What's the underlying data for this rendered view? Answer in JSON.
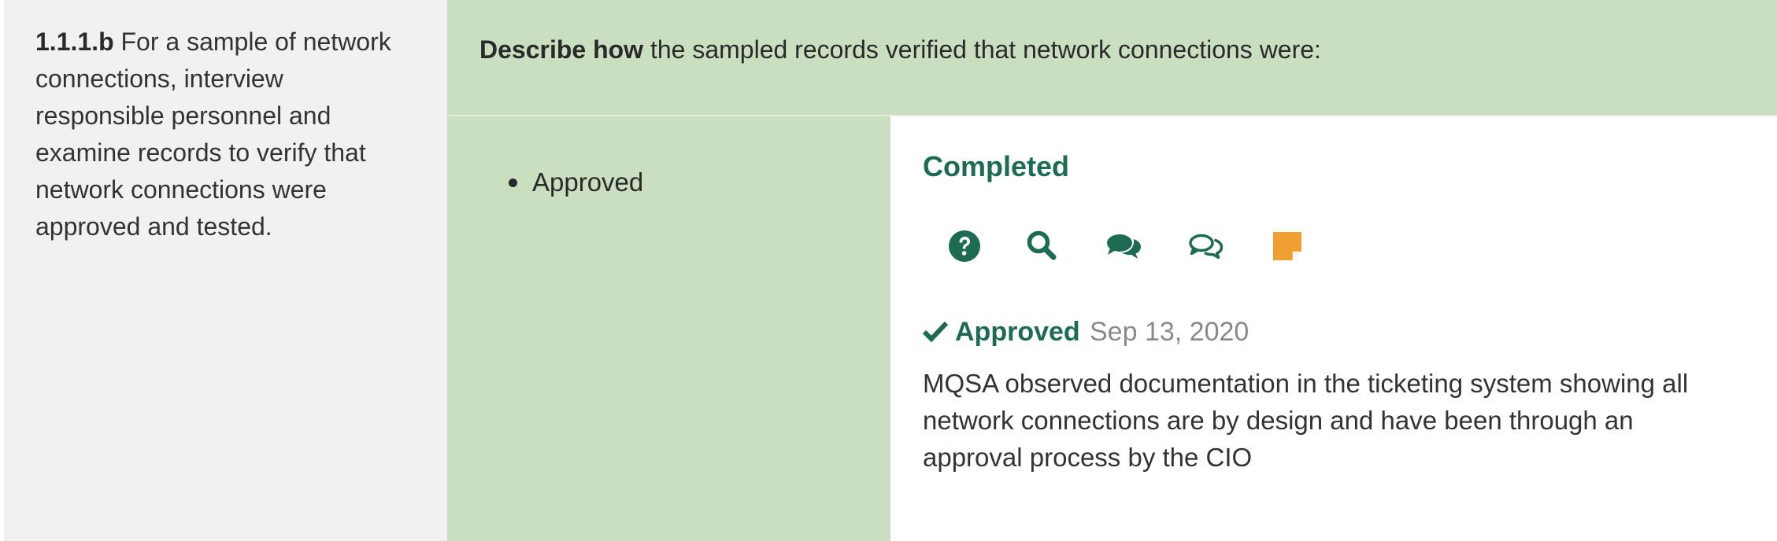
{
  "requirement": {
    "id": "1.1.1.b",
    "text": "For a sample of network connections, interview responsible personnel and examine records to verify that network connections were approved and tested."
  },
  "describe": {
    "lead": "Describe how",
    "rest": " the sampled records verified that network connections were:"
  },
  "items": [
    {
      "label": "Approved"
    }
  ],
  "answer": {
    "status": "Completed",
    "icons": [
      {
        "name": "help-icon",
        "color": "#1d6b52"
      },
      {
        "name": "search-icon",
        "color": "#1d6b52"
      },
      {
        "name": "comments-icon",
        "color": "#1d6b52"
      },
      {
        "name": "comments-outline-icon",
        "color": "#1d6b52"
      },
      {
        "name": "sticky-note-icon",
        "color": "#f0a030"
      }
    ],
    "approval": {
      "label": "Approved",
      "date": "Sep 13, 2020"
    },
    "comment": "MQSA observed documentation in the ticketing system showing all network connections are by design and have been through an approval process by the CIO"
  },
  "colors": {
    "accent": "#1d6b52",
    "green_bg": "#c9dfc0",
    "grey_bg": "#f1f1f1",
    "note": "#f0a030"
  }
}
